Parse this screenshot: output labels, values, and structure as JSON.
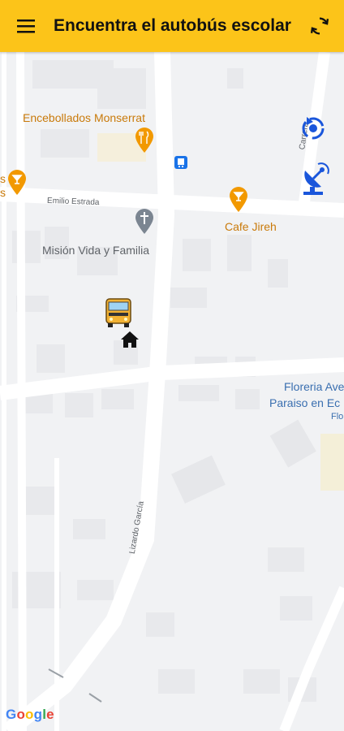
{
  "app": {
    "title": "Encuentra el autobús escolar"
  },
  "map": {
    "places": {
      "encebollados": "Encebollados Monserrat",
      "cafe": "Cafe Jireh",
      "mision": "Misión Vida y Familia",
      "floreria_line1": "Floreria Ave",
      "floreria_line2": "Paraiso en Ec",
      "floreria_line3": "Flo",
      "left_poi_a": "s",
      "left_poi_b": "s"
    },
    "streets": {
      "emilio": "Emilio Estrada",
      "lizardo": "Lizardo García",
      "carrera": "Carrera"
    },
    "attribution": "Google"
  },
  "colors": {
    "appbar": "#fcc419",
    "poi_orange": "#f29900",
    "poi_blue": "#1a56db",
    "map_bg": "#f1f2f4"
  }
}
